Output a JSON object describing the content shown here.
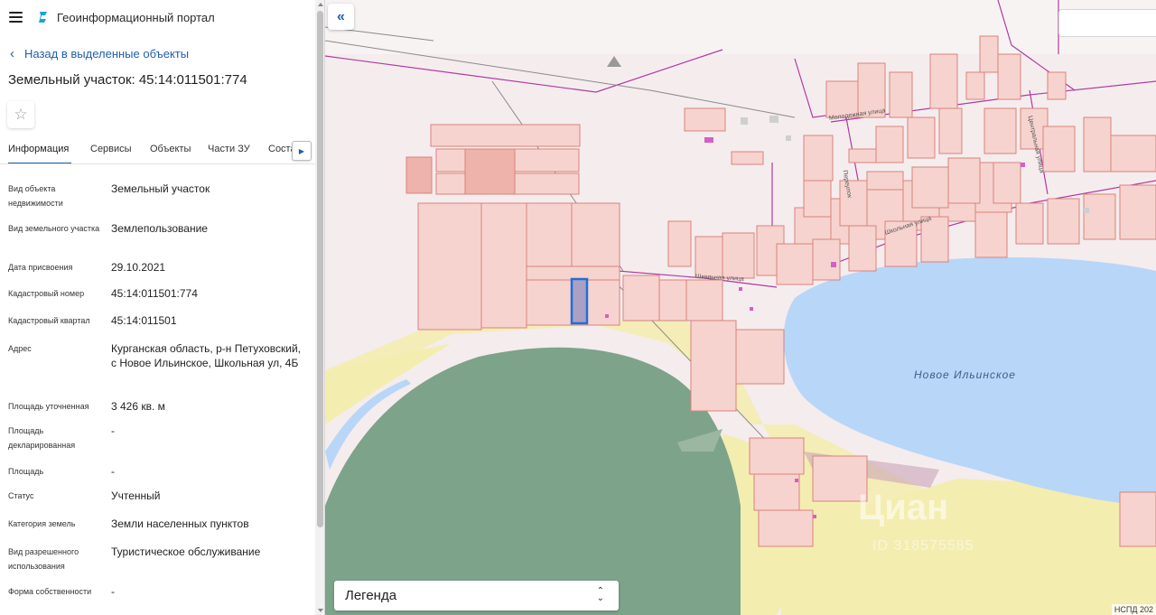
{
  "app": {
    "title": "Геоинформационный портал"
  },
  "nav": {
    "back_label": "Назад в выделенные объекты"
  },
  "object": {
    "title": "Земельный участок: 45:14:011501:774"
  },
  "tabs": [
    "Информация",
    "Сервисы",
    "Объекты",
    "Части ЗУ",
    "Соста"
  ],
  "properties": [
    {
      "label": "Вид объекта недвижимости",
      "value": "Земельный участок"
    },
    {
      "label": "Вид земельного участка",
      "value": "Землепользование"
    },
    {
      "label": "Дата присвоения",
      "value": "29.10.2021"
    },
    {
      "label": "Кадастровый номер",
      "value": "45:14:011501:774"
    },
    {
      "label": "Кадастровый квартал",
      "value": "45:14:011501"
    },
    {
      "label": "Адрес",
      "value": "Курганская область, р-н Петуховский, с Новое Ильинское, Школьная ул, 4Б"
    },
    {
      "label": "Площадь уточненная",
      "value": "3 426 кв. м"
    },
    {
      "label": "Площадь декларированная",
      "value": "-"
    },
    {
      "label": "Площадь",
      "value": "-"
    },
    {
      "label": "Статус",
      "value": "Учтенный"
    },
    {
      "label": "Категория земель",
      "value": "Земли населенных пунктов"
    },
    {
      "label": "Вид разрешенного использования",
      "value": "Туристическое обслуживание"
    },
    {
      "label": "Форма собственности",
      "value": "-"
    }
  ],
  "map": {
    "legend_label": "Легенда",
    "lake_label": "Новое Ильинское",
    "copyright": "НСПД 202",
    "streets": [
      "Молодежная улица",
      "Центральная улица",
      "Школьная улица",
      "Школьная улица",
      "Переулок"
    ],
    "watermark": "Циан",
    "watermark_id": "ID 318575585"
  },
  "colors": {
    "accent": "#1f5fad",
    "parcel_fill": "#f6d3cf",
    "parcel_stroke": "#d9837b",
    "selected_parcel": "#1e6fd9",
    "water": "#b8d6f7",
    "forest": "#7da38b",
    "sand": "#f4edb0"
  }
}
